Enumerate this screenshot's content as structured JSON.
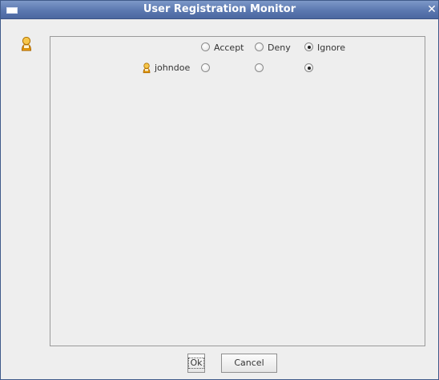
{
  "window": {
    "title": "User Registration Monitor"
  },
  "icons": {
    "window_menu": "window-menu-icon",
    "close": "close-icon",
    "user": "user-icon"
  },
  "header_options": {
    "accept": "Accept",
    "deny": "Deny",
    "ignore": "Ignore"
  },
  "users": [
    {
      "name": "johndoe",
      "selected": "Ignore"
    }
  ],
  "buttons": {
    "ok": "Ok",
    "cancel": "Cancel"
  },
  "colors": {
    "titlebar": "#5b78b0",
    "title_text": "#ffffff",
    "background": "#eeeeee",
    "icon": "#f0a000"
  }
}
